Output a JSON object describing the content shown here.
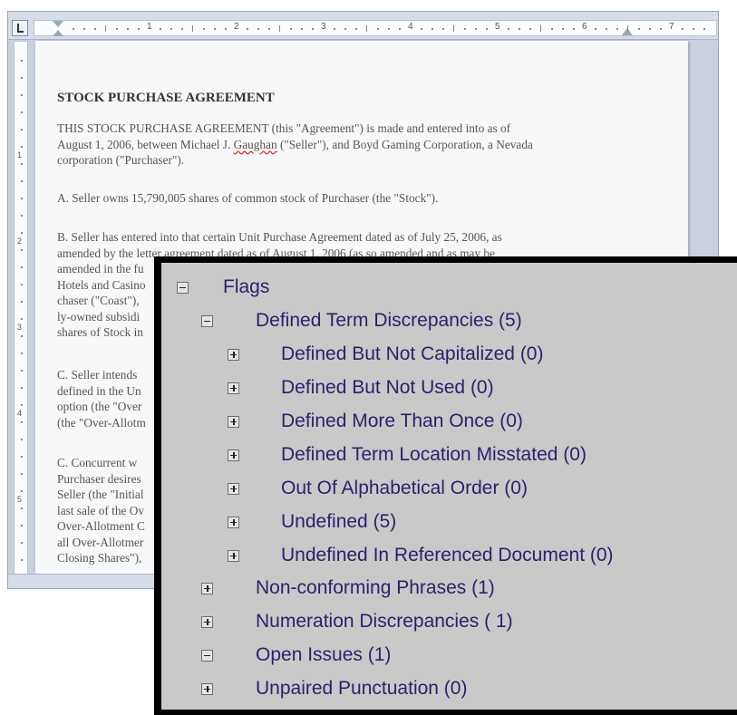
{
  "document": {
    "title": "STOCK PURCHASE AGREEMENT",
    "paragraphs": [
      {
        "lines": [
          "THIS STOCK PURCHASE AGREEMENT (this \"Agreement\") is made and entered into as of",
          "August 1, 2006, between Michael J. ",
          "Gaughan",
          " (\"Seller\"), and Boyd Gaming Corporation, a Nevada",
          "corporation (\"Purchaser\")."
        ]
      },
      {
        "lines": [
          "A.  Seller owns 15,790,005 shares of common stock of Purchaser (the \"Stock\")."
        ]
      },
      {
        "lines": [
          "B.  Seller has entered into that certain Unit Purchase Agreement dated as of July 25, 2006, as",
          "amended by the letter agreement dated as of August 1, 2006 (as so amended and as may be",
          "amended in the fu",
          "Hotels and Casino",
          "chaser (\"Coast\"),",
          "ly-owned subsidi",
          "shares of Stock in"
        ]
      },
      {
        "lines": [
          "C.  Seller intends",
          "defined in the Un",
          "option (the \"Over",
          "(the \"Over-Allotm"
        ]
      },
      {
        "lines": [
          "C.  Concurrent w",
          "Purchaser desires",
          "Seller (the \"Initial",
          "last sale of the Ov",
          "Over-Allotment C",
          "all Over-Allotmer",
          "Closing Shares\"),"
        ]
      }
    ]
  },
  "ruler": {
    "numbers": [
      "1",
      "2",
      "3",
      "4",
      "5",
      "6",
      "7"
    ],
    "vertical_numbers": [
      "1",
      "2",
      "3",
      "4",
      "5"
    ]
  },
  "flags_panel": {
    "items": [
      {
        "label": "Flags",
        "icon": "minus-box-icon"
      },
      {
        "label": "Defined Term Discrepancies (5)",
        "icon": "minus-box-icon"
      },
      {
        "label": "Defined But Not Capitalized (0)",
        "icon": "plus-box-icon"
      },
      {
        "label": "Defined But Not Used (0)",
        "icon": "plus-box-icon"
      },
      {
        "label": "Defined More Than Once (0)",
        "icon": "plus-box-icon"
      },
      {
        "label": "Defined Term Location Misstated (0)",
        "icon": "plus-box-icon"
      },
      {
        "label": "Out Of Alphabetical Order (0)",
        "icon": "plus-box-icon"
      },
      {
        "label": "Undefined (5)",
        "icon": "plus-box-icon"
      },
      {
        "label": "Undefined In Referenced Document (0)",
        "icon": "plus-box-icon"
      },
      {
        "label": "Non-conforming Phrases (1)",
        "icon": "plus-box-icon"
      },
      {
        "label": "Numeration Discrepancies ( 1)",
        "icon": "plus-box-icon"
      },
      {
        "label": "Open Issues (1)",
        "icon": "minus-box-icon"
      },
      {
        "label": "Unpaired Punctuation (0)",
        "icon": "plus-box-icon"
      }
    ]
  },
  "colors": {
    "tree_text": "#2f1f6a",
    "panel_background": "#c9c9c9",
    "page_background": "#f7f8fa",
    "misspelling_underline": "#dd3333"
  }
}
